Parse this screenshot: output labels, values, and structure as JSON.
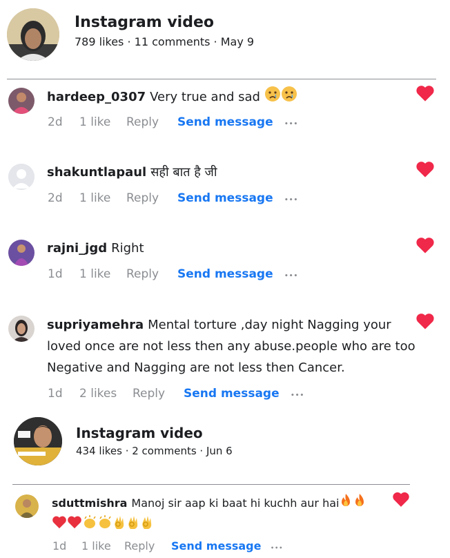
{
  "posts": [
    {
      "title": "Instagram video",
      "likes": "789 likes",
      "comments_count": "11 comments",
      "date": "May 9",
      "comments": [
        {
          "user": "hardeep_0307",
          "text": "Very true and sad",
          "time": "2d",
          "likes": "1 like",
          "reply": "Reply",
          "send": "Send message",
          "more": "•••"
        },
        {
          "user": "shakuntlapaul",
          "text": "सही बात है जी",
          "time": "2d",
          "likes": "1 like",
          "reply": "Reply",
          "send": "Send message",
          "more": "•••"
        },
        {
          "user": "rajni_jgd",
          "text": "Right",
          "time": "1d",
          "likes": "1 like",
          "reply": "Reply",
          "send": "Send message",
          "more": "•••"
        },
        {
          "user": "supriyamehra",
          "text_lines": [
            "Mental torture ,day night Nagging your",
            "loved once are not less then any abuse.people who are too",
            "Negative and Nagging are not less then Cancer."
          ],
          "time": "1d",
          "likes": "2 likes",
          "reply": "Reply",
          "send": "Send message",
          "more": "•••"
        }
      ]
    },
    {
      "title": "Instagram video",
      "likes": "434 likes",
      "comments_count": "2 comments",
      "date": "Jun 6",
      "comments": [
        {
          "user": "sduttmishra",
          "text": "Manoj sir aap ki baat hi kuchh aur hai",
          "time": "1d",
          "likes": "1 like",
          "reply": "Reply",
          "send": "Send message",
          "more": "•••"
        }
      ]
    }
  ],
  "separator": " · ",
  "colors": {
    "heart": "#f02849",
    "link": "#1877f2",
    "meta": "#8a8d91"
  },
  "icons": [
    "heart-icon",
    "crying-face-emoji",
    "fire-emoji",
    "ok-hand-emoji",
    "clapping-hands-emoji"
  ]
}
